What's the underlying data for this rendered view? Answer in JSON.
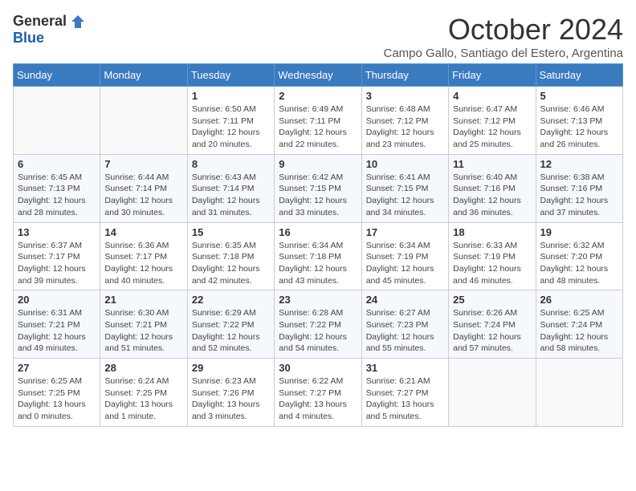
{
  "logo": {
    "general": "General",
    "blue": "Blue"
  },
  "header": {
    "title": "October 2024",
    "subtitle": "Campo Gallo, Santiago del Estero, Argentina"
  },
  "weekdays": [
    "Sunday",
    "Monday",
    "Tuesday",
    "Wednesday",
    "Thursday",
    "Friday",
    "Saturday"
  ],
  "weeks": [
    [
      {
        "day": "",
        "info": ""
      },
      {
        "day": "",
        "info": ""
      },
      {
        "day": "1",
        "info": "Sunrise: 6:50 AM\nSunset: 7:11 PM\nDaylight: 12 hours and 20 minutes."
      },
      {
        "day": "2",
        "info": "Sunrise: 6:49 AM\nSunset: 7:11 PM\nDaylight: 12 hours and 22 minutes."
      },
      {
        "day": "3",
        "info": "Sunrise: 6:48 AM\nSunset: 7:12 PM\nDaylight: 12 hours and 23 minutes."
      },
      {
        "day": "4",
        "info": "Sunrise: 6:47 AM\nSunset: 7:12 PM\nDaylight: 12 hours and 25 minutes."
      },
      {
        "day": "5",
        "info": "Sunrise: 6:46 AM\nSunset: 7:13 PM\nDaylight: 12 hours and 26 minutes."
      }
    ],
    [
      {
        "day": "6",
        "info": "Sunrise: 6:45 AM\nSunset: 7:13 PM\nDaylight: 12 hours and 28 minutes."
      },
      {
        "day": "7",
        "info": "Sunrise: 6:44 AM\nSunset: 7:14 PM\nDaylight: 12 hours and 30 minutes."
      },
      {
        "day": "8",
        "info": "Sunrise: 6:43 AM\nSunset: 7:14 PM\nDaylight: 12 hours and 31 minutes."
      },
      {
        "day": "9",
        "info": "Sunrise: 6:42 AM\nSunset: 7:15 PM\nDaylight: 12 hours and 33 minutes."
      },
      {
        "day": "10",
        "info": "Sunrise: 6:41 AM\nSunset: 7:15 PM\nDaylight: 12 hours and 34 minutes."
      },
      {
        "day": "11",
        "info": "Sunrise: 6:40 AM\nSunset: 7:16 PM\nDaylight: 12 hours and 36 minutes."
      },
      {
        "day": "12",
        "info": "Sunrise: 6:38 AM\nSunset: 7:16 PM\nDaylight: 12 hours and 37 minutes."
      }
    ],
    [
      {
        "day": "13",
        "info": "Sunrise: 6:37 AM\nSunset: 7:17 PM\nDaylight: 12 hours and 39 minutes."
      },
      {
        "day": "14",
        "info": "Sunrise: 6:36 AM\nSunset: 7:17 PM\nDaylight: 12 hours and 40 minutes."
      },
      {
        "day": "15",
        "info": "Sunrise: 6:35 AM\nSunset: 7:18 PM\nDaylight: 12 hours and 42 minutes."
      },
      {
        "day": "16",
        "info": "Sunrise: 6:34 AM\nSunset: 7:18 PM\nDaylight: 12 hours and 43 minutes."
      },
      {
        "day": "17",
        "info": "Sunrise: 6:34 AM\nSunset: 7:19 PM\nDaylight: 12 hours and 45 minutes."
      },
      {
        "day": "18",
        "info": "Sunrise: 6:33 AM\nSunset: 7:19 PM\nDaylight: 12 hours and 46 minutes."
      },
      {
        "day": "19",
        "info": "Sunrise: 6:32 AM\nSunset: 7:20 PM\nDaylight: 12 hours and 48 minutes."
      }
    ],
    [
      {
        "day": "20",
        "info": "Sunrise: 6:31 AM\nSunset: 7:21 PM\nDaylight: 12 hours and 49 minutes."
      },
      {
        "day": "21",
        "info": "Sunrise: 6:30 AM\nSunset: 7:21 PM\nDaylight: 12 hours and 51 minutes."
      },
      {
        "day": "22",
        "info": "Sunrise: 6:29 AM\nSunset: 7:22 PM\nDaylight: 12 hours and 52 minutes."
      },
      {
        "day": "23",
        "info": "Sunrise: 6:28 AM\nSunset: 7:22 PM\nDaylight: 12 hours and 54 minutes."
      },
      {
        "day": "24",
        "info": "Sunrise: 6:27 AM\nSunset: 7:23 PM\nDaylight: 12 hours and 55 minutes."
      },
      {
        "day": "25",
        "info": "Sunrise: 6:26 AM\nSunset: 7:24 PM\nDaylight: 12 hours and 57 minutes."
      },
      {
        "day": "26",
        "info": "Sunrise: 6:25 AM\nSunset: 7:24 PM\nDaylight: 12 hours and 58 minutes."
      }
    ],
    [
      {
        "day": "27",
        "info": "Sunrise: 6:25 AM\nSunset: 7:25 PM\nDaylight: 13 hours and 0 minutes."
      },
      {
        "day": "28",
        "info": "Sunrise: 6:24 AM\nSunset: 7:25 PM\nDaylight: 13 hours and 1 minute."
      },
      {
        "day": "29",
        "info": "Sunrise: 6:23 AM\nSunset: 7:26 PM\nDaylight: 13 hours and 3 minutes."
      },
      {
        "day": "30",
        "info": "Sunrise: 6:22 AM\nSunset: 7:27 PM\nDaylight: 13 hours and 4 minutes."
      },
      {
        "day": "31",
        "info": "Sunrise: 6:21 AM\nSunset: 7:27 PM\nDaylight: 13 hours and 5 minutes."
      },
      {
        "day": "",
        "info": ""
      },
      {
        "day": "",
        "info": ""
      }
    ]
  ]
}
